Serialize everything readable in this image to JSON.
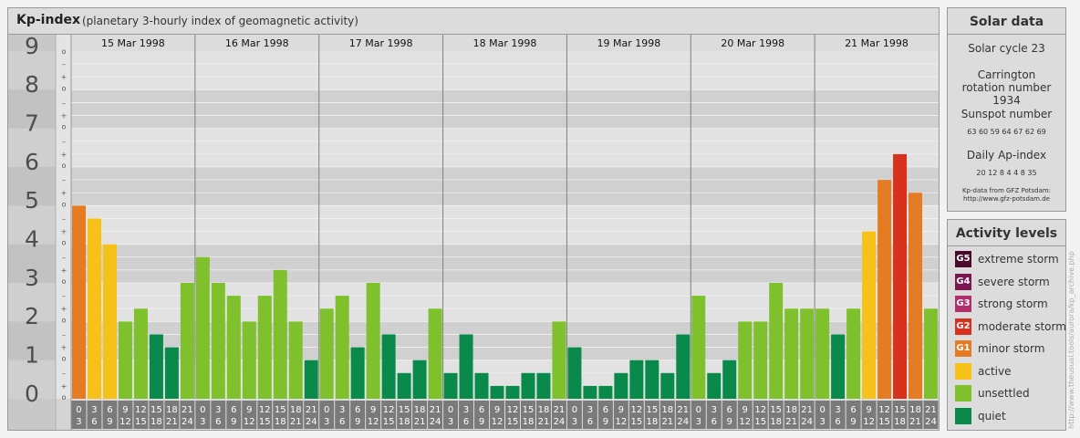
{
  "header": {
    "title": "Kp-index",
    "subtitle": "(planetary 3-hourly index of geomagnetic activity)"
  },
  "chart_data": {
    "type": "bar",
    "title": "Kp-index",
    "subtitle": "(planetary 3-hourly index of geomagnetic activity)",
    "ylim": [
      0,
      9
    ],
    "y_ticks": [
      "0",
      "1",
      "2",
      "3",
      "4",
      "5",
      "6",
      "7",
      "8",
      "9"
    ],
    "y_minor_labels": [
      "+",
      "o",
      "–"
    ],
    "days": [
      "15 Mar 1998",
      "16 Mar 1998",
      "17 Mar 1998",
      "18 Mar 1998",
      "19 Mar 1998",
      "20 Mar 1998",
      "21 Mar 1998"
    ],
    "interval_labels": [
      [
        "0",
        "3"
      ],
      [
        "3",
        "6"
      ],
      [
        "6",
        "9"
      ],
      [
        "9",
        "12"
      ],
      [
        "12",
        "15"
      ],
      [
        "15",
        "18"
      ],
      [
        "18",
        "21"
      ],
      [
        "21",
        "24"
      ]
    ],
    "values": [
      [
        5.0,
        4.667,
        4.0,
        2.0,
        2.333,
        1.667,
        1.333,
        3.0
      ],
      [
        3.667,
        3.0,
        2.667,
        2.0,
        2.667,
        3.333,
        2.0,
        1.0
      ],
      [
        2.333,
        2.667,
        1.333,
        3.0,
        1.667,
        0.667,
        1.0,
        2.333
      ],
      [
        0.667,
        1.667,
        0.667,
        0.333,
        0.333,
        0.667,
        0.667,
        2.0
      ],
      [
        1.333,
        0.333,
        0.333,
        0.667,
        1.0,
        1.0,
        0.667,
        1.667
      ],
      [
        2.667,
        0.667,
        1.0,
        2.0,
        2.0,
        3.0,
        2.333,
        2.333
      ],
      [
        2.333,
        1.667,
        2.333,
        4.333,
        5.667,
        6.333,
        5.333,
        2.333
      ]
    ],
    "grid": true,
    "legend": "right"
  },
  "solar": {
    "title": "Solar data",
    "cycle": "Solar cycle 23",
    "carrington": "Carrington rotation number 1934",
    "sunspot_title": "Sunspot number",
    "sunspot_values": "63 60 59 64 67 62 69",
    "ap_title": "Daily Ap-index",
    "ap_values": "20 12 8 4 4 8 35",
    "source_line1": "Kp-data from GFZ Potsdam:",
    "source_line2": "http://www.gfz-potsdam.de"
  },
  "levels": {
    "title": "Activity levels",
    "items": [
      {
        "code": "G5",
        "label": "extreme storm",
        "color": "#4a0a2a"
      },
      {
        "code": "G4",
        "label": "severe storm",
        "color": "#7a1650"
      },
      {
        "code": "G3",
        "label": "strong storm",
        "color": "#b0306e"
      },
      {
        "code": "G2",
        "label": "moderate storm",
        "color": "#d8321f"
      },
      {
        "code": "G1",
        "label": "minor storm",
        "color": "#e57b22"
      },
      {
        "code": "",
        "label": "active",
        "color": "#f6c21a"
      },
      {
        "code": "",
        "label": "unsettled",
        "color": "#7ec12c"
      },
      {
        "code": "",
        "label": "quiet",
        "color": "#0a8a4a"
      }
    ]
  },
  "watermark": "http://www.theusual.tools/aurora/kp_archive.php"
}
